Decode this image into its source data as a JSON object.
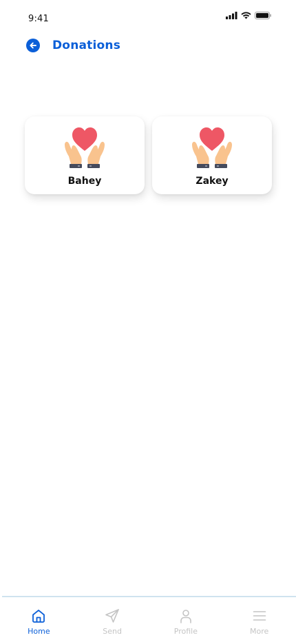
{
  "status_bar": {
    "time": "9:41"
  },
  "header": {
    "title": "Donations",
    "back_icon": "arrow-left-icon"
  },
  "donations": [
    {
      "name": "Bahey",
      "icon": "heart-in-hands-icon"
    },
    {
      "name": "Zakey",
      "icon": "heart-in-hands-icon"
    }
  ],
  "bottom_nav": {
    "items": [
      {
        "label": "Home",
        "icon": "home-icon",
        "active": true
      },
      {
        "label": "Send",
        "icon": "send-icon",
        "active": false
      },
      {
        "label": "Profile",
        "icon": "user-icon",
        "active": false
      },
      {
        "label": "More",
        "icon": "menu-icon",
        "active": false
      }
    ],
    "active_color": "#0b5fd8",
    "inactive_color": "#c4c4c4"
  },
  "colors": {
    "accent": "#0b5fd8",
    "heart": "#ee5765",
    "hand": "#f9c38e"
  }
}
